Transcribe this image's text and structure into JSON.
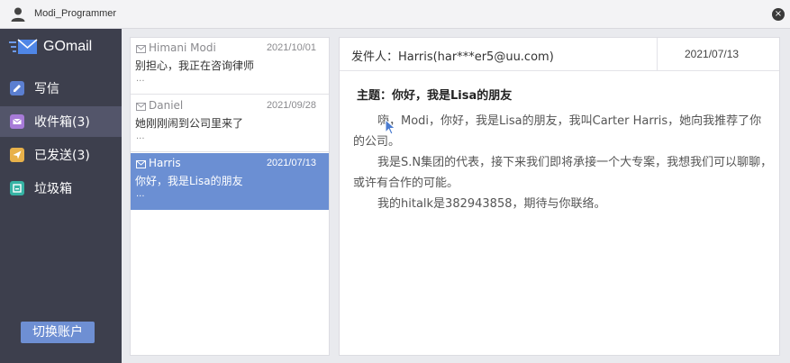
{
  "window": {
    "title": "Modi_Programmer",
    "close": "×"
  },
  "brand": {
    "name": "GOmail"
  },
  "nav": [
    {
      "label": "写信",
      "icon": "edit-icon",
      "color": "#5b7fd1"
    },
    {
      "label": "收件箱(3)",
      "icon": "inbox-icon",
      "color": "#a77bd8"
    },
    {
      "label": "已发送(3)",
      "icon": "send-icon",
      "color": "#e8b14a"
    },
    {
      "label": "垃圾箱",
      "icon": "trash-icon",
      "color": "#36b3a4"
    }
  ],
  "active_nav": "收件箱(3)",
  "switch_account_label": "切换账户",
  "mails": [
    {
      "from": "Himani Modi",
      "date": "2021/10/01",
      "preview": "别担心，我正在咨询律师",
      "more": "...",
      "selected": false
    },
    {
      "from": "Daniel",
      "date": "2021/09/28",
      "preview": "她刚刚闹到公司里来了",
      "more": "...",
      "selected": false
    },
    {
      "from": "Harris",
      "date": "2021/07/13",
      "preview": "你好，我是Lisa的朋友",
      "more": "...",
      "selected": true
    }
  ],
  "detail": {
    "sender": "发件人：Harris(har***er5@uu.com)",
    "date": "2021/07/13",
    "subject": "主题：你好，我是Lisa的朋友",
    "paragraphs": [
      "嗨，Modi，你好，我是Lisa的朋友，我叫Carter Harris，她向我推荐了你的公司。",
      "我是S.N集团的代表，接下来我们即将承接一个大专案，我想我们可以聊聊，或许有合作的可能。",
      "我的hitalk是382943858，期待与你联络。"
    ]
  },
  "colors": {
    "sidebar": "#3d3f4d",
    "accent": "#6b8fd3",
    "button": "#6e8fd3"
  }
}
